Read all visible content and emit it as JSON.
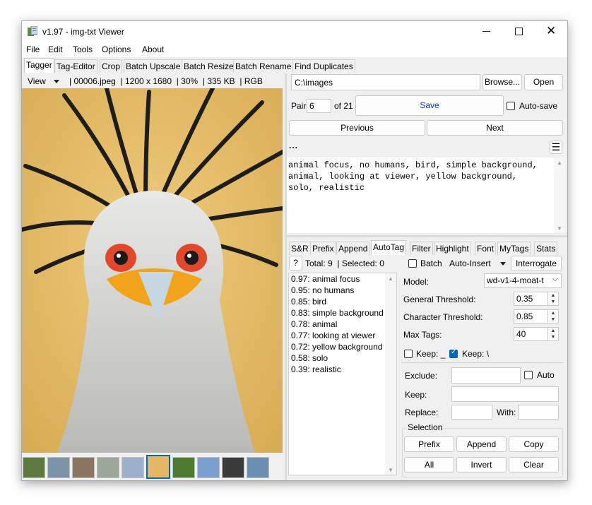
{
  "window": {
    "title": "v1.97 - img-txt Viewer"
  },
  "menu": [
    "File",
    "Edit",
    "Tools",
    "Options",
    "About"
  ],
  "main_tabs": [
    "Tagger",
    "Tag-Editor",
    "Crop",
    "Batch Upscale",
    "Batch Resize",
    "Batch Rename",
    "Find Duplicates"
  ],
  "image_info": {
    "view_label": "View",
    "filename": "00006.jpeg",
    "dimensions": "1200 x 1680",
    "zoom": "30%",
    "filesize": "335 KB",
    "mode": "RGB"
  },
  "path": {
    "value": "C:\\images",
    "browse": "Browse...",
    "open": "Open"
  },
  "pair": {
    "label": "Pair",
    "value": "6",
    "of": "of 21",
    "save": "Save",
    "autosave": "Auto-save"
  },
  "nav": {
    "previous": "Previous",
    "next": "Next",
    "ellipsis": "..."
  },
  "caption": "animal focus, no humans, bird, simple background, animal, looking at viewer, yellow background, solo, realistic",
  "tool_tabs": [
    "S&R",
    "Prefix",
    "Append",
    "AutoTag",
    "Filter",
    "Highlight",
    "Font",
    "MyTags",
    "Stats"
  ],
  "autotag": {
    "help": "?",
    "total": "Total: 9",
    "selected": "Selected: 0",
    "batch": "Batch",
    "auto_insert": "Auto-Insert",
    "interrogate": "Interrogate",
    "results": [
      "0.97: animal focus",
      "0.95: no humans",
      "0.85: bird",
      "0.83: simple background",
      "0.78: animal",
      "0.77: looking at viewer",
      "0.72: yellow background",
      "0.58: solo",
      "0.39: realistic"
    ],
    "model_label": "Model:",
    "model_value": "wd-v1-4-moat-t",
    "general_label": "General Threshold:",
    "general_value": "0.35",
    "character_label": "Character Threshold:",
    "character_value": "0.85",
    "maxtags_label": "Max Tags:",
    "maxtags_value": "40",
    "keep_underscore": "Keep: _",
    "keep_backslash": "Keep: \\",
    "exclude_label": "Exclude:",
    "auto_label": "Auto",
    "keep_label": "Keep:",
    "replace_label": "Replace:",
    "with_label": "With:",
    "selection_label": "Selection",
    "buttons": {
      "prefix": "Prefix",
      "append": "Append",
      "copy": "Copy",
      "all": "All",
      "invert": "Invert",
      "clear": "Clear"
    }
  },
  "colors": {
    "accent": "#0067c0",
    "window_bg": "#f0f0f0",
    "image_bg": "#e3b766"
  }
}
